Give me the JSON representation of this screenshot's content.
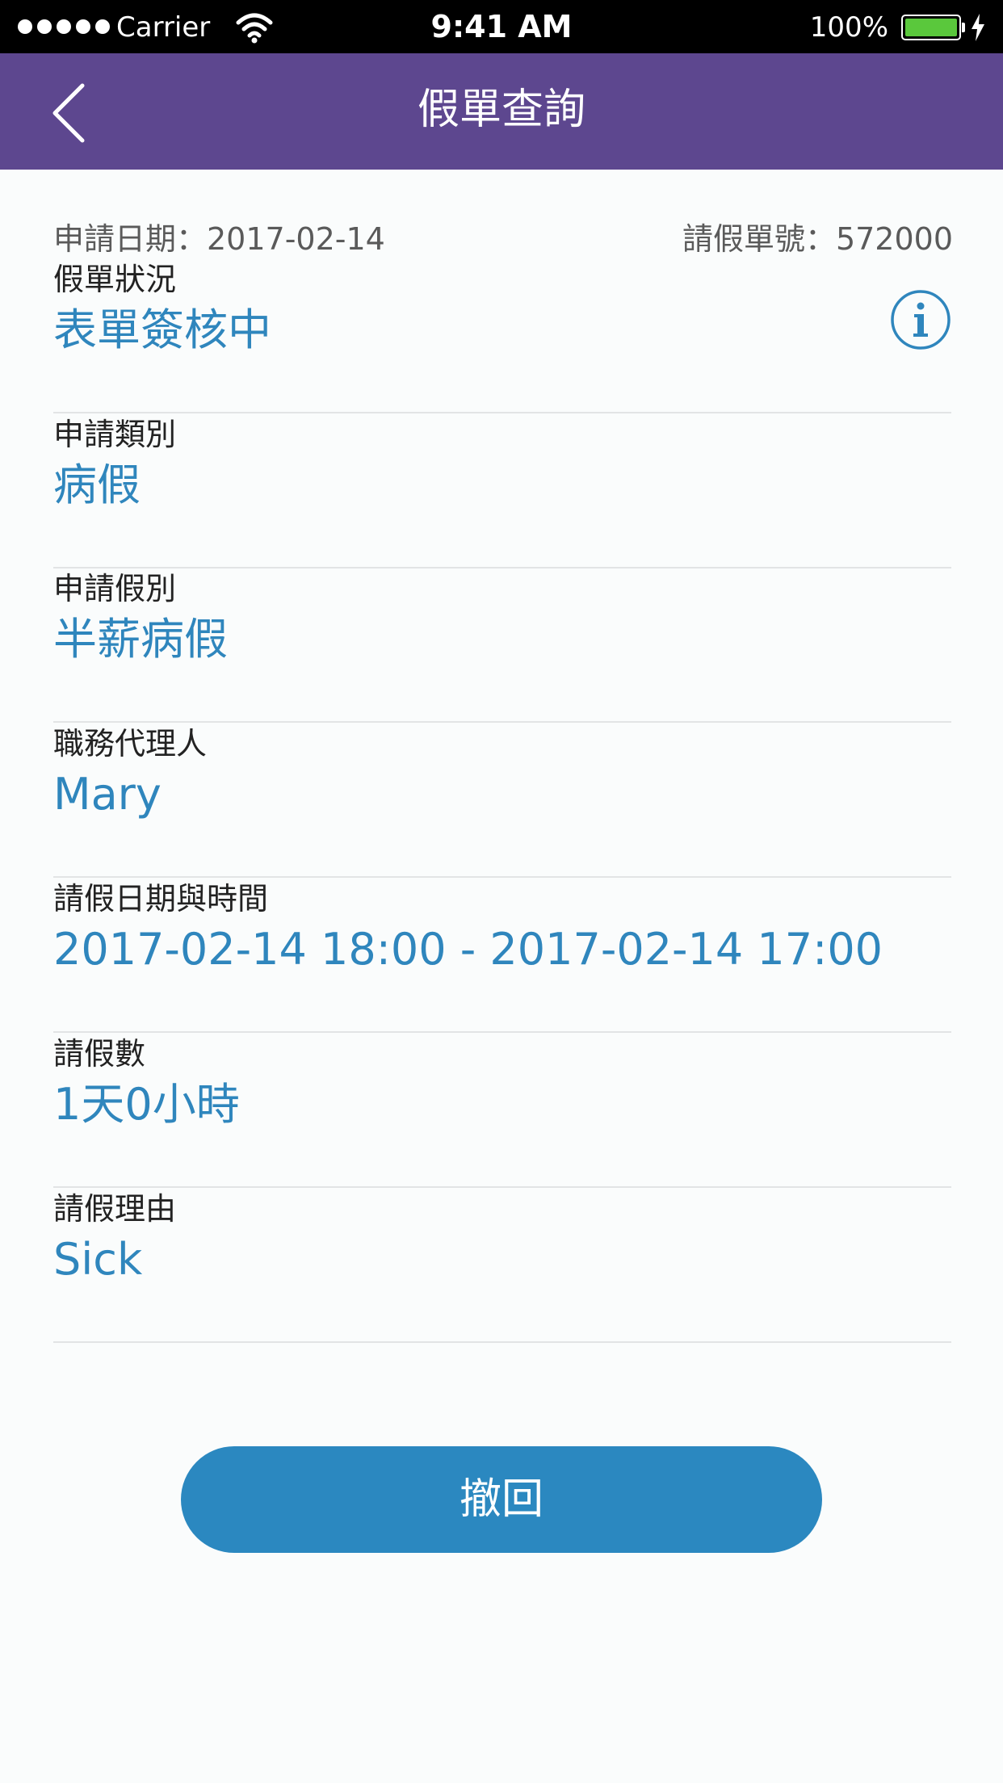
{
  "status_bar": {
    "carrier": "Carrier",
    "time": "9:41 AM",
    "battery": "100%"
  },
  "nav": {
    "title": "假單查詢",
    "back_icon": "chevron-left-icon"
  },
  "meta": {
    "apply_date": "申請日期：2017-02-14",
    "form_number": "請假單號：572000"
  },
  "fields": [
    {
      "label": "假單狀況",
      "value": "表單簽核中",
      "icon": "info-icon"
    },
    {
      "label": "申請類別",
      "value": "病假"
    },
    {
      "label": "申請假別",
      "value": "半薪病假"
    },
    {
      "label": "職務代理人",
      "value": "Mary"
    },
    {
      "label": "請假日期與時間",
      "value": "2017-02-14 18:00 - 2017-02-14 17:00"
    },
    {
      "label": "請假數",
      "value": "1天0小時"
    },
    {
      "label": "請假理由",
      "value": "Sick"
    }
  ],
  "actions": {
    "withdraw_label": "撤回"
  },
  "colors": {
    "nav_bg": "#5d478f",
    "accent": "#2f86bd",
    "button_bg": "#2b88c0",
    "battery": "#5ac83c"
  }
}
